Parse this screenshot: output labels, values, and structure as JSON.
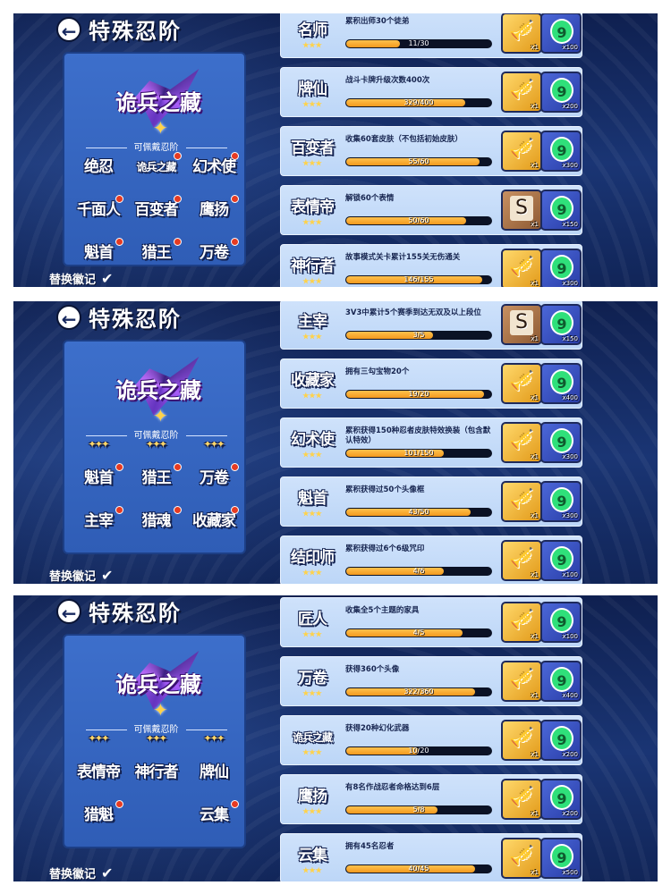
{
  "header": {
    "back_icon": "←",
    "title": "特殊忍阶"
  },
  "featured_badge": {
    "text": "诡兵之藏",
    "star": "✦"
  },
  "wearable_label": "可佩戴忍阶",
  "replace_label": "替换徽记",
  "check_glyph": "✔",
  "colors": {
    "reward_gold": "#f0b43a",
    "reward_blue": "#3550c0",
    "progress_fill": "#f5a623",
    "red_dot": "#e63b22"
  },
  "panels": [
    {
      "badge_rows": [
        {
          "partial": false,
          "items": [
            {
              "text": "绝忍",
              "dot": false
            },
            {
              "text": "诡兵之藏",
              "dot": true
            },
            {
              "text": "幻术使",
              "dot": true
            }
          ]
        },
        {
          "partial": false,
          "items": [
            {
              "text": "千面人",
              "dot": true
            },
            {
              "text": "百变者",
              "dot": true
            },
            {
              "text": "鹰扬",
              "dot": true
            }
          ]
        },
        {
          "partial": false,
          "items": [
            {
              "text": "魁首",
              "dot": true
            },
            {
              "text": "猎王",
              "dot": true
            },
            {
              "text": "万卷",
              "dot": true
            }
          ]
        }
      ],
      "achievements": [
        {
          "name": "名师",
          "desc": "累积出师30个徒弟",
          "progress": "11/30",
          "fraction": 0.37,
          "reward1": {
            "type": "gold",
            "icon": "🎺",
            "count": "x1"
          },
          "reward2": {
            "icon": "9",
            "count": "x100"
          }
        },
        {
          "name": "牌仙",
          "desc": "战斗卡牌升级次数400次",
          "progress": "329/400",
          "fraction": 0.82,
          "reward1": {
            "type": "gold",
            "icon": "🎺",
            "count": "x1"
          },
          "reward2": {
            "icon": "9",
            "count": "x200"
          }
        },
        {
          "name": "百变者",
          "desc": "收集60套皮肤（不包括初始皮肤）",
          "progress": "55/60",
          "fraction": 0.92,
          "reward1": {
            "type": "gold",
            "icon": "🎺",
            "count": "x1"
          },
          "reward2": {
            "icon": "9",
            "count": "x300"
          }
        },
        {
          "name": "表情帝",
          "desc": "解锁60个表情",
          "progress": "50/60",
          "fraction": 0.83,
          "reward1": {
            "type": "brown",
            "icon": "S",
            "count": "x1"
          },
          "reward2": {
            "icon": "9",
            "count": "x150"
          }
        },
        {
          "name": "神行者",
          "desc": "故事模式关卡累计155关无伤通关",
          "progress": "146/155",
          "fraction": 0.94,
          "reward1": {
            "type": "gold",
            "icon": "🎺",
            "count": "x1"
          },
          "reward2": {
            "icon": "9",
            "count": "x300"
          }
        }
      ]
    },
    {
      "badge_rows": [
        {
          "partial": true,
          "items": [
            {
              "text": "✦✦✦",
              "dot": false
            },
            {
              "text": "✦✦✦",
              "dot": false
            },
            {
              "text": "✦✦✦",
              "dot": false
            }
          ]
        },
        {
          "partial": false,
          "items": [
            {
              "text": "魁首",
              "dot": true
            },
            {
              "text": "猎王",
              "dot": true
            },
            {
              "text": "万卷",
              "dot": true
            }
          ]
        },
        {
          "partial": false,
          "items": [
            {
              "text": "主宰",
              "dot": true
            },
            {
              "text": "猎魂",
              "dot": true
            },
            {
              "text": "收藏家",
              "dot": true
            }
          ]
        }
      ],
      "achievements": [
        {
          "name": "主宰",
          "desc": "3V3中累计5个赛季到达无双及以上段位",
          "progress": "3/5",
          "fraction": 0.6,
          "reward1": {
            "type": "brown",
            "icon": "S",
            "count": "x1"
          },
          "reward2": {
            "icon": "9",
            "count": "x150"
          }
        },
        {
          "name": "收藏家",
          "desc": "拥有三勾宝物20个",
          "progress": "19/20",
          "fraction": 0.95,
          "reward1": {
            "type": "gold",
            "icon": "🎺",
            "count": "x1"
          },
          "reward2": {
            "icon": "9",
            "count": "x400"
          }
        },
        {
          "name": "幻术使",
          "desc": "累积获得150种忍者皮肤特效换装（包含默认特效）",
          "progress": "101/150",
          "fraction": 0.67,
          "reward1": {
            "type": "gold",
            "icon": "🎺",
            "count": "x1"
          },
          "reward2": {
            "icon": "9",
            "count": "x300"
          }
        },
        {
          "name": "魁首",
          "desc": "累积获得过50个头像框",
          "progress": "43/50",
          "fraction": 0.86,
          "reward1": {
            "type": "gold",
            "icon": "🎺",
            "count": "x1"
          },
          "reward2": {
            "icon": "9",
            "count": "x300"
          }
        },
        {
          "name": "结印师",
          "desc": "累积获得过6个6级咒印",
          "progress": "4/6",
          "fraction": 0.67,
          "reward1": {
            "type": "gold",
            "icon": "🎺",
            "count": "x1"
          },
          "reward2": {
            "icon": "9",
            "count": "x100"
          }
        }
      ]
    },
    {
      "badge_rows": [
        {
          "partial": true,
          "items": [
            {
              "text": "✦✦✦",
              "dot": false
            },
            {
              "text": "✦✦✦",
              "dot": false
            },
            {
              "text": "✦✦✦",
              "dot": false
            }
          ]
        },
        {
          "partial": false,
          "items": [
            {
              "text": "表情帝",
              "dot": false
            },
            {
              "text": "神行者",
              "dot": false
            },
            {
              "text": "牌仙",
              "dot": false
            }
          ]
        },
        {
          "partial": false,
          "items": [
            {
              "text": "猎魁",
              "dot": true
            },
            {
              "text": "云集",
              "dot": true
            }
          ]
        }
      ],
      "achievements": [
        {
          "name": "匠人",
          "desc": "收集全5个主题的家具",
          "progress": "4/5",
          "fraction": 0.8,
          "reward1": {
            "type": "gold",
            "icon": "🎺",
            "count": "x1"
          },
          "reward2": {
            "icon": "9",
            "count": "x100"
          }
        },
        {
          "name": "万卷",
          "desc": "获得360个头像",
          "progress": "322/360",
          "fraction": 0.89,
          "reward1": {
            "type": "gold",
            "icon": "🎺",
            "count": "x1"
          },
          "reward2": {
            "icon": "9",
            "count": "x400"
          }
        },
        {
          "name": "诡兵之藏",
          "desc": "获得20种幻化武器",
          "progress": "10/20",
          "fraction": 0.5,
          "reward1": {
            "type": "gold",
            "icon": "🎺",
            "count": "x1"
          },
          "reward2": {
            "icon": "9",
            "count": "x200"
          }
        },
        {
          "name": "鹰扬",
          "desc": "有8名作战忍者命格达到6层",
          "progress": "5/8",
          "fraction": 0.63,
          "reward1": {
            "type": "gold",
            "icon": "🎺",
            "count": "x1"
          },
          "reward2": {
            "icon": "9",
            "count": "x200"
          }
        },
        {
          "name": "云集",
          "desc": "拥有45名忍者",
          "progress": "40/45",
          "fraction": 0.89,
          "reward1": {
            "type": "gold",
            "icon": "🎺",
            "count": "x1"
          },
          "reward2": {
            "icon": "9",
            "count": "x500"
          }
        }
      ]
    }
  ]
}
